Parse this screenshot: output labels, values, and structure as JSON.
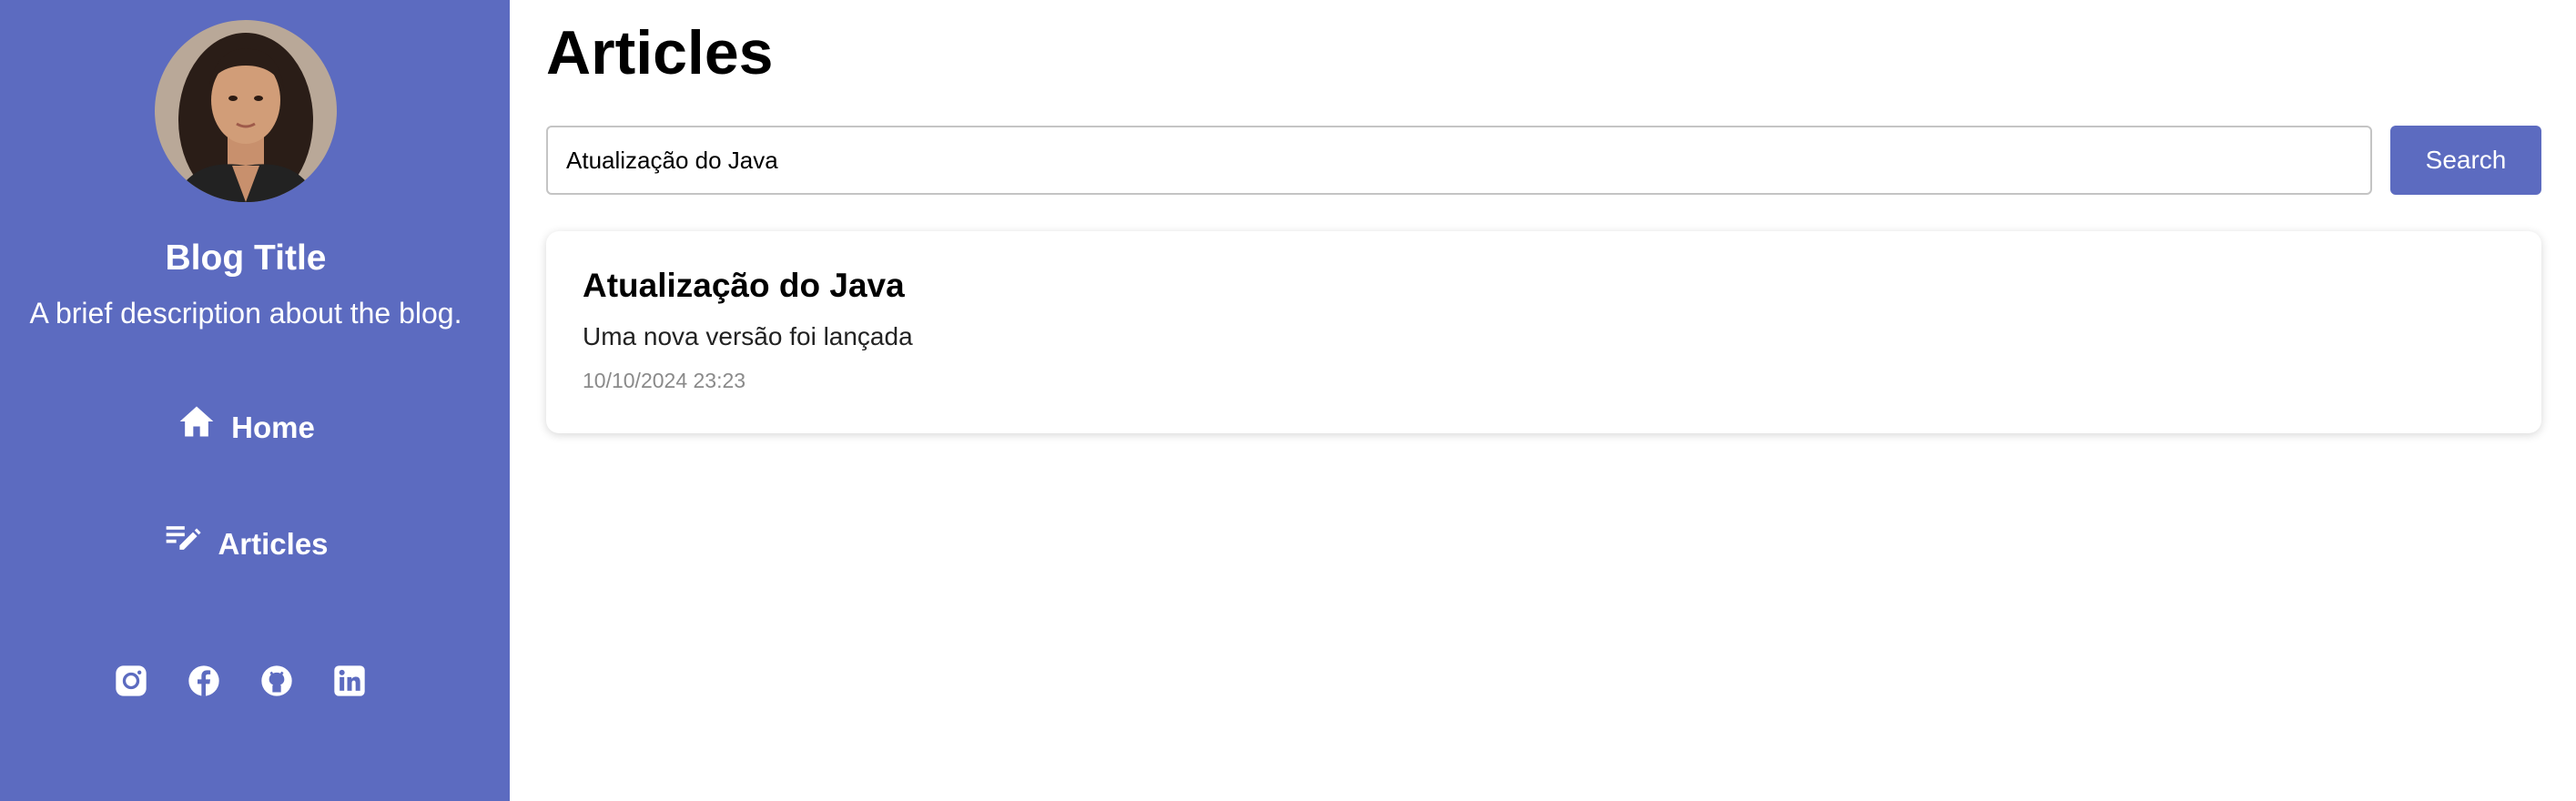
{
  "colors": {
    "sidebar_bg": "#5c6bc0",
    "button_bg": "#5c6bc0",
    "text_on_accent": "#ffffff",
    "date_text": "#8a8a8a"
  },
  "sidebar": {
    "avatar_icon": "profile-photo",
    "blog_title": "Blog Title",
    "blog_description": "A brief description about the blog.",
    "nav": [
      {
        "label": "Home",
        "icon": "home-icon"
      },
      {
        "label": "Articles",
        "icon": "edit-note-icon"
      }
    ],
    "social": [
      {
        "icon": "instagram-icon"
      },
      {
        "icon": "facebook-icon"
      },
      {
        "icon": "github-icon"
      },
      {
        "icon": "linkedin-icon"
      }
    ]
  },
  "main": {
    "page_title": "Articles",
    "search": {
      "value": "Atualização do Java",
      "button_label": "Search"
    },
    "articles": [
      {
        "title": "Atualização do Java",
        "summary": "Uma nova versão foi lançada",
        "date": "10/10/2024 23:23"
      }
    ]
  }
}
